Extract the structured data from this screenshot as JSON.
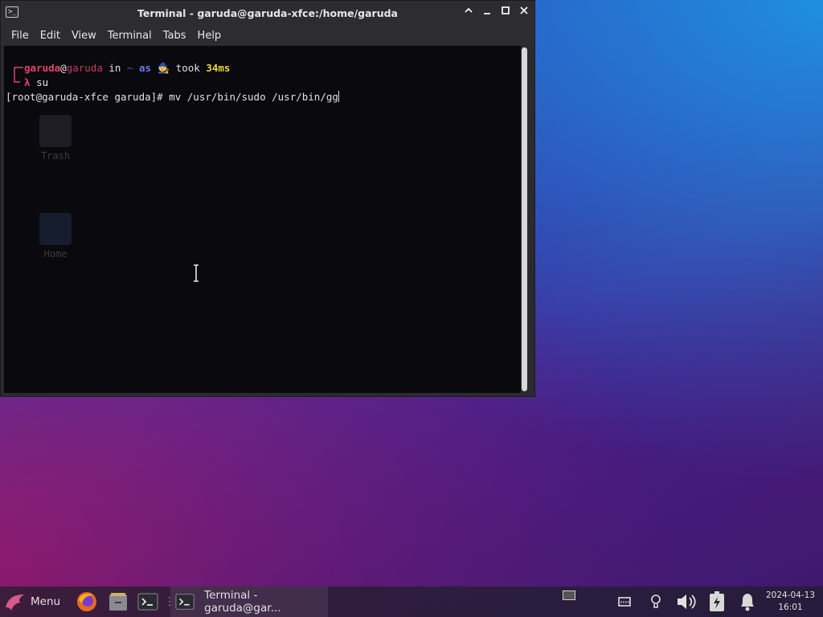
{
  "window": {
    "title": "Terminal - garuda@garuda-xfce:/home/garuda",
    "menus": [
      "File",
      "Edit",
      "View",
      "Terminal",
      "Tabs",
      "Help"
    ]
  },
  "terminal": {
    "prompt_user": "garuda",
    "prompt_at": "@",
    "prompt_host": "garuda",
    "prompt_in": " in ",
    "prompt_dir": "~",
    "prompt_as": " as ",
    "prompt_took": " took ",
    "prompt_time": "34ms",
    "lambda": "λ",
    "cmd1": "su",
    "root_line": "[root@garuda-xfce garuda]# mv /usr/bin/sudo /usr/bin/gg"
  },
  "desktop": {
    "icons": [
      "Trash",
      "Home"
    ]
  },
  "taskbar": {
    "menu_label": "Menu",
    "task_label": "Terminal - garuda@gar...",
    "date": "2024-04-13",
    "time": "16:01"
  },
  "colors": {
    "prompt_red": "#e0436b",
    "prompt_blue": "#6b78e8",
    "prompt_yellow": "#e9d83e"
  }
}
